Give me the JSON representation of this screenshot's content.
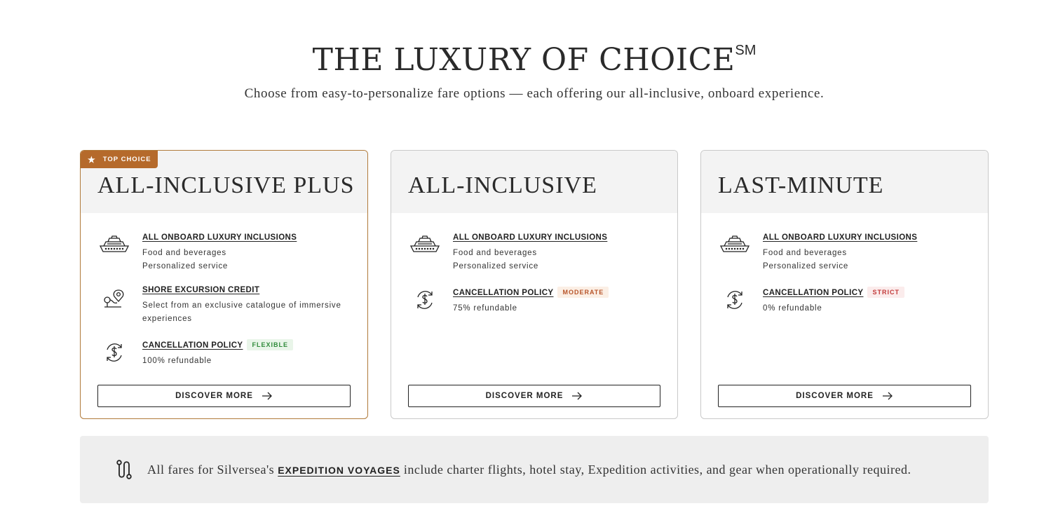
{
  "hero": {
    "title": "THE LUXURY OF CHOICE",
    "title_mark": "SM",
    "subtitle": "Choose from easy-to-personalize fare options — each offering our all-inclusive, onboard experience."
  },
  "cards": [
    {
      "badge": "TOP CHOICE",
      "title": "ALL-INCLUSIVE PLUS",
      "features": [
        {
          "icon": "ship-icon",
          "title": "ALL ONBOARD LUXURY INCLUSIONS",
          "lines": [
            "Food and beverages",
            "Personalized service"
          ]
        },
        {
          "icon": "map-pin-route-icon",
          "title": "SHORE EXCURSION CREDIT",
          "lines": [
            "Select from an exclusive catalogue of immersive",
            "experiences"
          ]
        },
        {
          "icon": "refund-dollar-icon",
          "title": "CANCELLATION POLICY",
          "tag": "FLEXIBLE",
          "lines": [
            "100% refundable"
          ]
        }
      ],
      "cta": "DISCOVER MORE"
    },
    {
      "title": "ALL-INCLUSIVE",
      "features": [
        {
          "icon": "ship-icon",
          "title": "ALL ONBOARD LUXURY INCLUSIONS",
          "lines": [
            "Food and beverages",
            "Personalized service"
          ]
        },
        {
          "icon": "refund-dollar-icon",
          "title": "CANCELLATION POLICY",
          "tag": "MODERATE",
          "lines": [
            "75% refundable"
          ]
        }
      ],
      "cta": "DISCOVER MORE"
    },
    {
      "title": "LAST-MINUTE",
      "features": [
        {
          "icon": "ship-icon",
          "title": "ALL ONBOARD LUXURY INCLUSIONS",
          "lines": [
            "Food and beverages",
            "Personalized service"
          ]
        },
        {
          "icon": "refund-dollar-icon",
          "title": "CANCELLATION POLICY",
          "tag": "STRICT",
          "lines": [
            "0% refundable"
          ]
        }
      ],
      "cta": "DISCOVER MORE"
    }
  ],
  "note": {
    "before": "All fares for Silversea's ",
    "link": "EXPEDITION VOYAGES",
    "after": " include charter flights, hotel stay, Expedition activities, and gear when operationally required."
  },
  "colors": {
    "accent": "#b56a2b",
    "flexible": "#2f8a3a",
    "moderate": "#b8552a",
    "strict": "#c23a3a"
  }
}
